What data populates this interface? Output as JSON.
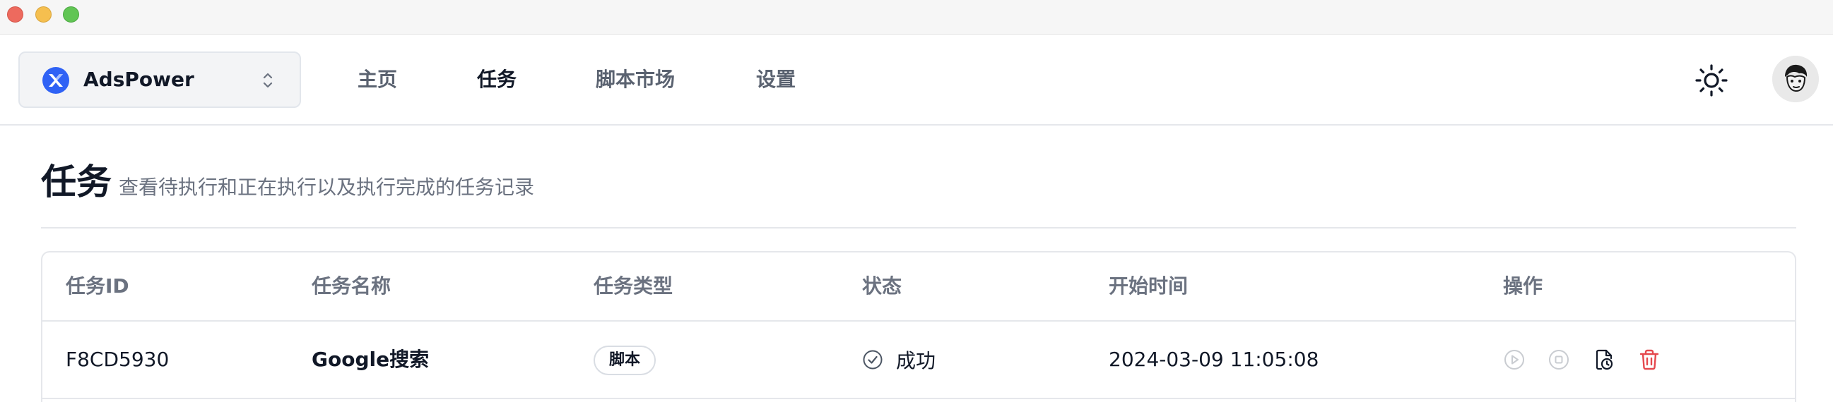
{
  "window": {
    "controls": [
      "close",
      "minimize",
      "zoom"
    ]
  },
  "brand": {
    "name": "AdsPower",
    "logo_icon": "adspower-logo-icon",
    "chevron_icon": "chevron-up-down-icon"
  },
  "nav": {
    "home": "主页",
    "tasks": "任务",
    "market": "脚本市场",
    "settings": "设置",
    "active": "tasks"
  },
  "header": {
    "theme_icon": "sun-icon",
    "avatar_icon": "avatar-icon"
  },
  "page": {
    "title": "任务",
    "subtitle": "查看待执行和正在执行以及执行完成的任务记录"
  },
  "table": {
    "columns": [
      "任务ID",
      "任务名称",
      "任务类型",
      "状态",
      "开始时间",
      "操作"
    ],
    "rows": [
      {
        "id": "F8CD5930",
        "name": "Google搜索",
        "type": "脚本",
        "status": "成功",
        "status_icon": "check-circle-icon",
        "start_time": "2024-03-09 11:05:08",
        "actions": [
          "play-icon",
          "stop-icon",
          "file-clock-icon",
          "trash-icon"
        ]
      }
    ]
  },
  "colors": {
    "danger": "#e5484d",
    "disabled": "#c9ccd1",
    "text": "#111827",
    "muted": "#6b7280",
    "brand": "#2f62f5"
  }
}
